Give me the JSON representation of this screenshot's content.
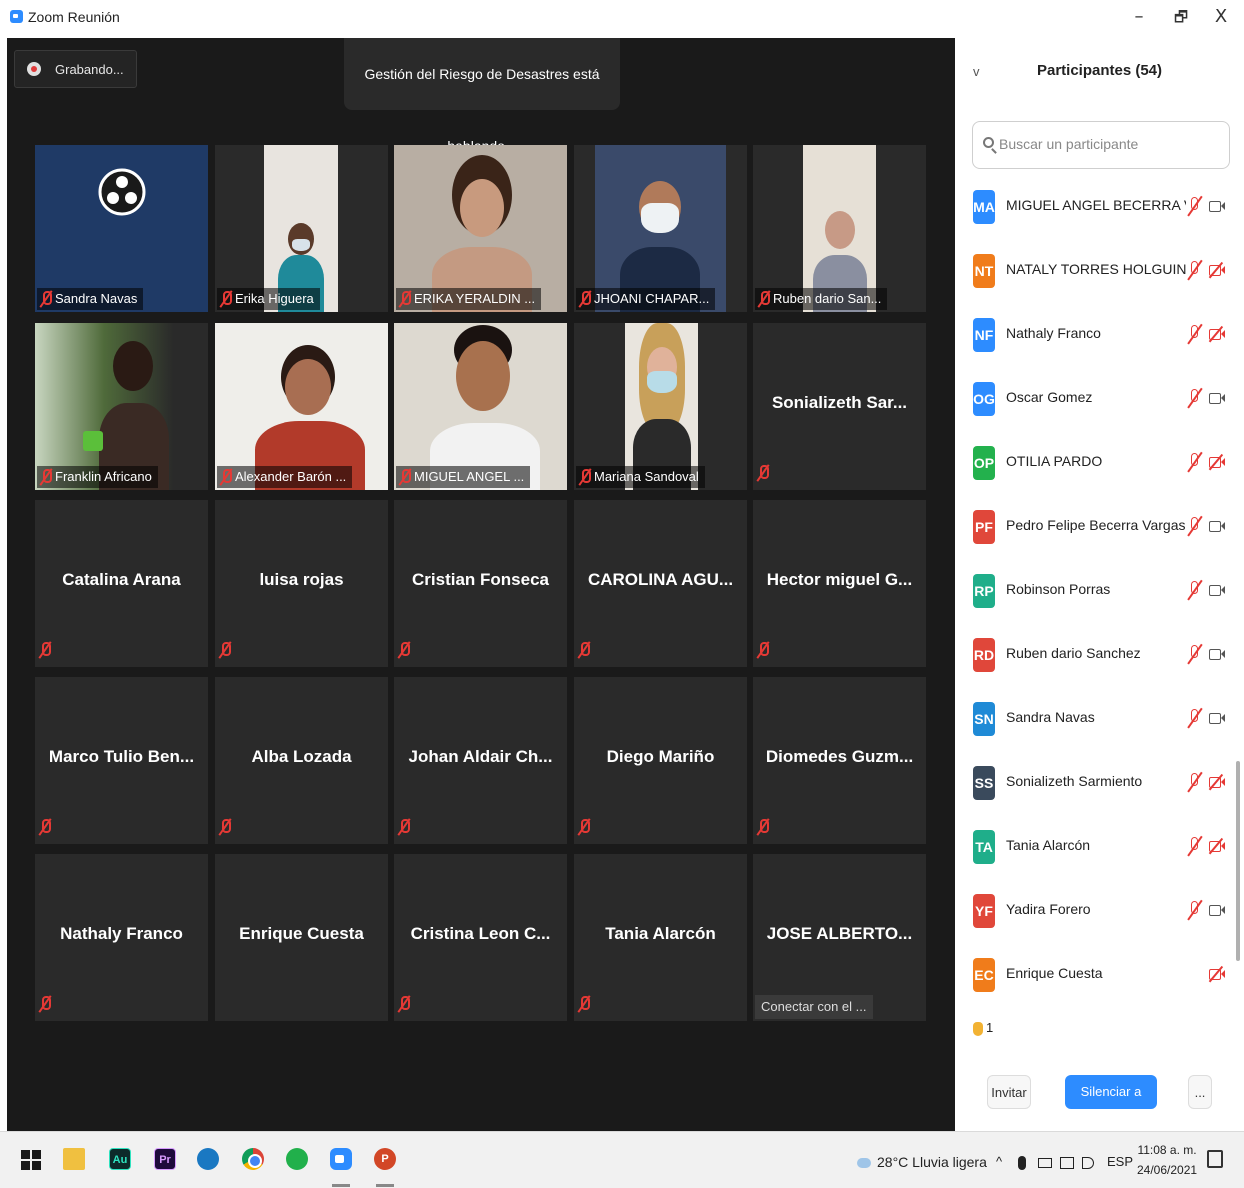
{
  "window": {
    "title": "Zoom Reunión",
    "minimize": "–",
    "restore": "🗗",
    "close": "X"
  },
  "meeting": {
    "recording_label": "Grabando...",
    "speaking_banner": "Gestión del Riesgo de Desastres está hablando...",
    "video_tiles": [
      {
        "label": "Sandra Navas"
      },
      {
        "label": "Erika Higuera"
      },
      {
        "label": "ERIKA YERALDIN ..."
      },
      {
        "label": "JHOANI CHAPAR..."
      },
      {
        "label": "Ruben dario San..."
      },
      {
        "label": "Franklin Africano"
      },
      {
        "label": "Alexander Barón ..."
      },
      {
        "label": "MIGUEL ANGEL ..."
      },
      {
        "label": "Mariana Sandoval"
      }
    ],
    "name_tiles": [
      {
        "name": "Sonializeth  Sar..."
      },
      {
        "name": "Catalina Arana"
      },
      {
        "name": "luisa rojas"
      },
      {
        "name": "Cristian Fonseca"
      },
      {
        "name": "CAROLINA AGU..."
      },
      {
        "name": "Hector miguel G..."
      },
      {
        "name": "Marco Tulio Ben..."
      },
      {
        "name": "Alba Lozada"
      },
      {
        "name": "Johan Aldair Ch..."
      },
      {
        "name": "Diego Mariño"
      },
      {
        "name": "Diomedes Guzm..."
      },
      {
        "name": "Nathaly Franco"
      },
      {
        "name": "Enrique Cuesta"
      },
      {
        "name": "Cristina Leon C..."
      },
      {
        "name": "Tania Alarcón"
      },
      {
        "name": "JOSE ALBERTO..."
      }
    ],
    "connecting_label": "Conectar con el ...",
    "icons": {
      "recording": "record-dot-icon",
      "mic_muted": "muted-mic-icon"
    }
  },
  "participants": {
    "collapse_icon": "v",
    "title": "Participantes (54)",
    "search_placeholder": "Buscar un participante",
    "items": [
      {
        "initials": "MA",
        "name": "MIGUEL ANGEL BECERRA VARG...",
        "color": "#2d8cff",
        "camera": "on"
      },
      {
        "initials": "NT",
        "name": "NATALY TORRES HOLGUIN",
        "color": "#f07c1b",
        "camera": "off"
      },
      {
        "initials": "NF",
        "name": "Nathaly Franco",
        "color": "#2d8cff",
        "camera": "off"
      },
      {
        "initials": "OG",
        "name": "Oscar Gomez",
        "color": "#2d8cff",
        "camera": "on"
      },
      {
        "initials": "OP",
        "name": "OTILIA PARDO",
        "color": "#23b14d",
        "camera": "off"
      },
      {
        "initials": "PF",
        "name": "Pedro Felipe Becerra Vargas",
        "color": "#e0473a",
        "camera": "on"
      },
      {
        "initials": "RP",
        "name": "Robinson Porras",
        "color": "#1fae8a",
        "camera": "on"
      },
      {
        "initials": "RD",
        "name": "Ruben dario Sanchez",
        "color": "#e0473a",
        "camera": "on"
      },
      {
        "initials": "SN",
        "name": "Sandra Navas",
        "color": "#1f8ad6",
        "camera": "on"
      },
      {
        "initials": "SS",
        "name": "Sonializeth Sarmiento",
        "color": "#3a4a5c",
        "camera": "off"
      },
      {
        "initials": "TA",
        "name": "Tania Alarcón",
        "color": "#1fae8a",
        "camera": "off"
      },
      {
        "initials": "YF",
        "name": "Yadira Forero",
        "color": "#e0473a",
        "camera": "on"
      },
      {
        "initials": "EC",
        "name": "Enrique Cuesta",
        "color": "#f07c1b",
        "camera": "off",
        "mic": "none"
      }
    ],
    "raised_hands": "1",
    "invite_label": "Invitar",
    "mute_all_label": "Silenciar a todos",
    "more_label": "..."
  },
  "taskbar": {
    "apps": [
      "windows-start-icon",
      "file-explorer-icon",
      "audition-icon",
      "premiere-icon",
      "edge-icon",
      "chrome-icon",
      "green-app-icon",
      "zoom-icon",
      "powerpoint-icon"
    ],
    "au_text": "Au",
    "pr_text": "Pr",
    "ppt_text": "P",
    "weather": "28°C  Lluvia ligera",
    "tray_caret": "^",
    "language": "ESP",
    "time": "11:08 a. m.",
    "date": "24/06/2021"
  }
}
